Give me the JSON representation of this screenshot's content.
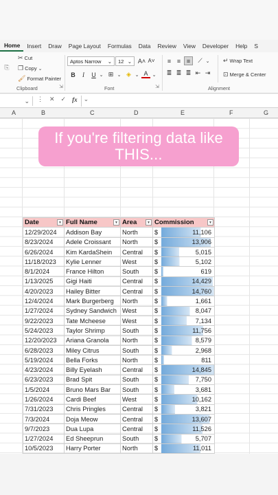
{
  "ribbon": {
    "tabs": [
      "Home",
      "Insert",
      "Draw",
      "Page Layout",
      "Formulas",
      "Data",
      "Review",
      "View",
      "Developer",
      "Help",
      "S"
    ],
    "active_tab": "Home",
    "clipboard": {
      "cut": "Cut",
      "copy": "Copy",
      "format_painter": "Format Painter",
      "group_label": "Clipboard"
    },
    "font": {
      "name": "Aptos Narrow",
      "size": "12",
      "grow": "A˄",
      "shrink": "A˅",
      "bold": "B",
      "italic": "I",
      "underline": "U",
      "color_a": "A",
      "group_label": "Font"
    },
    "alignment": {
      "wrap_text": "Wrap Text",
      "merge_center": "Merge & Center",
      "group_label": "Alignment"
    }
  },
  "formula_bar": {
    "fx": "fx",
    "cancel": "✕",
    "enter": "✓"
  },
  "columns": [
    "A",
    "B",
    "C",
    "D",
    "E",
    "F",
    "G"
  ],
  "caption": {
    "line1": "If you're filtering data like",
    "line2": "THIS..."
  },
  "table": {
    "headers": [
      "Date",
      "Full Name",
      "Area",
      "Commission"
    ],
    "rows": [
      [
        "12/29/2024",
        "Addison Bay",
        "North",
        "$",
        "11,106"
      ],
      [
        "8/23/2024",
        "Adele Croissant",
        "North",
        "$",
        "13,906"
      ],
      [
        "6/26/2024",
        "Kim KardaShein",
        "Central",
        "$",
        "5,015"
      ],
      [
        "11/18/2023",
        "Kylie Lenner",
        "West",
        "$",
        "5,102"
      ],
      [
        "8/1/2024",
        "France Hilton",
        "South",
        "$",
        "619"
      ],
      [
        "1/13/2025",
        "Gigi Haiti",
        "Central",
        "$",
        "14,429"
      ],
      [
        "4/20/2023",
        "Hailey Bitter",
        "Central",
        "$",
        "14,760"
      ],
      [
        "12/4/2024",
        "Mark Burgerberg",
        "North",
        "$",
        "1,661"
      ],
      [
        "1/27/2024",
        "Sydney Sandwich",
        "West",
        "$",
        "8,047"
      ],
      [
        "9/22/2023",
        "Tate Mcheese",
        "West",
        "$",
        "7,134"
      ],
      [
        "5/24/2023",
        "Taylor Shrimp",
        "South",
        "$",
        "11,756"
      ],
      [
        "12/20/2023",
        "Ariana Granola",
        "North",
        "$",
        "8,579"
      ],
      [
        "6/28/2023",
        "Miley Citrus",
        "South",
        "$",
        "2,968"
      ],
      [
        "5/19/2024",
        "Bella Forks",
        "North",
        "$",
        "811"
      ],
      [
        "4/23/2024",
        "Billy Eyelash",
        "Central",
        "$",
        "14,845"
      ],
      [
        "6/23/2023",
        "Brad Spit",
        "South",
        "$",
        "7,750"
      ],
      [
        "1/5/2024",
        "Bruno Mars Bar",
        "South",
        "$",
        "3,681"
      ],
      [
        "1/26/2024",
        "Cardi Beef",
        "West",
        "$",
        "10,162"
      ],
      [
        "7/31/2023",
        "Chris Pringles",
        "Central",
        "$",
        "3,821"
      ],
      [
        "7/3/2024",
        "Doja Meow",
        "Central",
        "$",
        "13,607"
      ],
      [
        "9/7/2023",
        "Dua Lupa",
        "Central",
        "$",
        "11,526"
      ],
      [
        "1/27/2024",
        "Ed Sheeprun",
        "South",
        "$",
        "5,707"
      ],
      [
        "10/5/2023",
        "Harry Porter",
        "North",
        "$",
        "11,011"
      ]
    ],
    "commission_values": [
      11106,
      13906,
      5015,
      5102,
      619,
      14429,
      14760,
      1661,
      8047,
      7134,
      11756,
      8579,
      2968,
      811,
      14845,
      7750,
      3681,
      10162,
      3821,
      13607,
      11526,
      5707,
      11011
    ],
    "bar_color": "#5b9bd5"
  }
}
